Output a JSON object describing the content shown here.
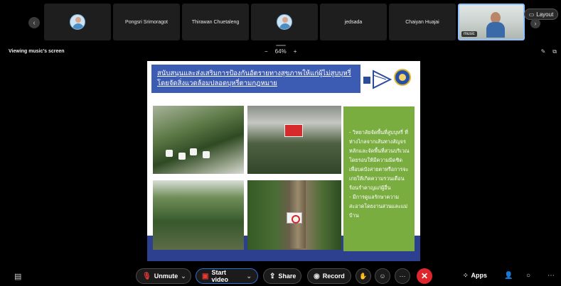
{
  "participants": [
    {
      "name": ""
    },
    {
      "name": "Pongsri Srimoragot"
    },
    {
      "name": "Thirawan Chuetaleng"
    },
    {
      "name": ""
    },
    {
      "name": "jedsada"
    },
    {
      "name": "Chaiyan Huajai"
    }
  ],
  "self_view": {
    "label": "music"
  },
  "layout_button": {
    "label": "Layout",
    "icon": "layout-icon"
  },
  "viewing": {
    "text": "Viewing music's screen"
  },
  "zoom": {
    "minus": "−",
    "level": "64%",
    "plus": "+"
  },
  "slide": {
    "title": "สนับสนุนและส่งเสริมการป้องกันอัตรายทางสุขภาพให้แก่ผู้ไม่สูบบุหรี่ โดยจัดสิ่งแวดล้อมปลอดบุหรี่ตามกฎหมาย",
    "green_text": "- วิทยาลัยจัดพื้นที่สูบบุหรี่ ที่ห่างไกลจากเส้นทางสัญจรหลักและจัดพื้นที่สวนบริเวณโดยรอบให้มีความมิดชิด เพื่อบดบังสายตาหรือการจะเกยให้เกิดความรวนเดือนร้อนรำคาญแก่ผู้อื่น\n- มีการดูแลรักษาความสะอาดโดยงานสวนและแม่บ้าน",
    "colors": {
      "header": "#3c5bb3",
      "green": "#7aad3f",
      "footer": "#2d3f8f"
    }
  },
  "toolbar": {
    "chat_icon": "chat-icon",
    "unmute_label": "Unmute",
    "start_video_label": "Start video",
    "share_label": "Share",
    "record_label": "Record",
    "apps_label": "Apps",
    "end_call_color": "#e0262d"
  }
}
